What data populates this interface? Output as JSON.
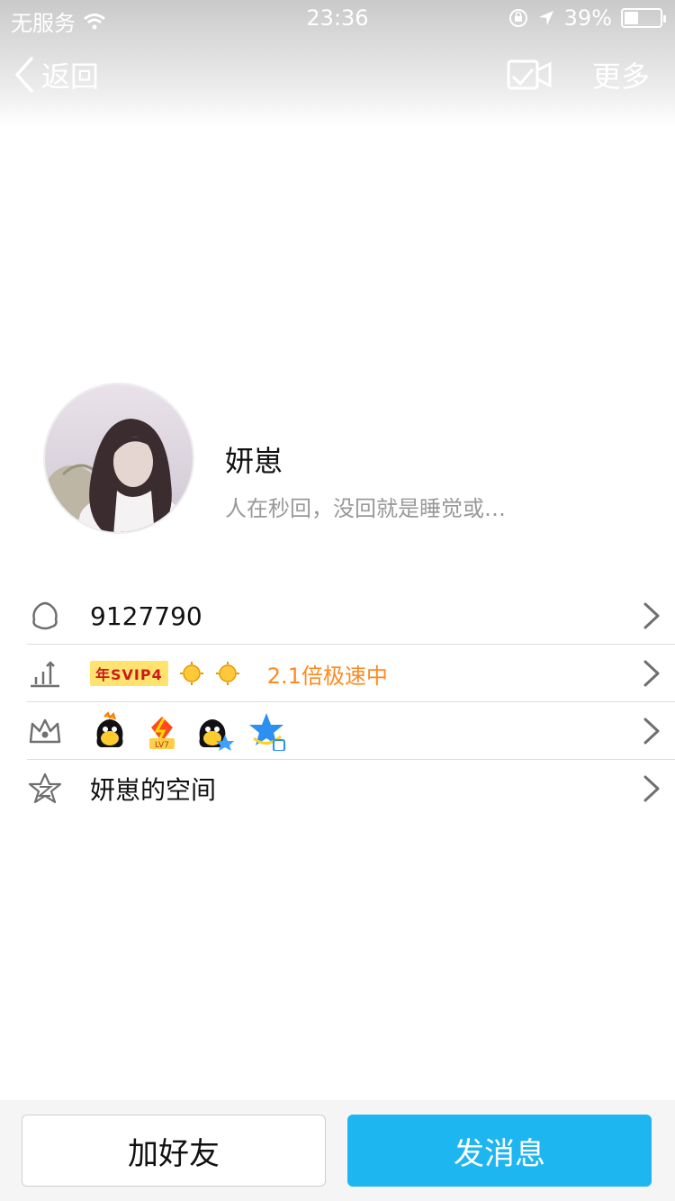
{
  "status_bar": {
    "carrier": "无服务",
    "time": "23:36",
    "battery_percent": "39%",
    "battery_level": 0.39
  },
  "nav": {
    "back_label": "返回",
    "more_label": "更多"
  },
  "profile": {
    "name": "妍崽",
    "signature": "人在秒回，没回就是睡觉或…"
  },
  "info": {
    "qq_number": "9127790",
    "vip_badge": "年SVIP4",
    "speed_text": "2.1倍极速中",
    "space_label": "妍崽的空间"
  },
  "actions": {
    "add_friend": "加好友",
    "send_message": "发消息"
  },
  "colors": {
    "accent": "#1eb6f0",
    "orange": "#ff8a1e",
    "svip_bg": "#ffe36e",
    "svip_text": "#cc1a1a"
  },
  "icons": {
    "qq": "qq-penguin-icon",
    "level": "level-chart-icon",
    "crown": "crown-icon",
    "star": "star-z-icon",
    "chevron": "chevron-right-icon"
  }
}
